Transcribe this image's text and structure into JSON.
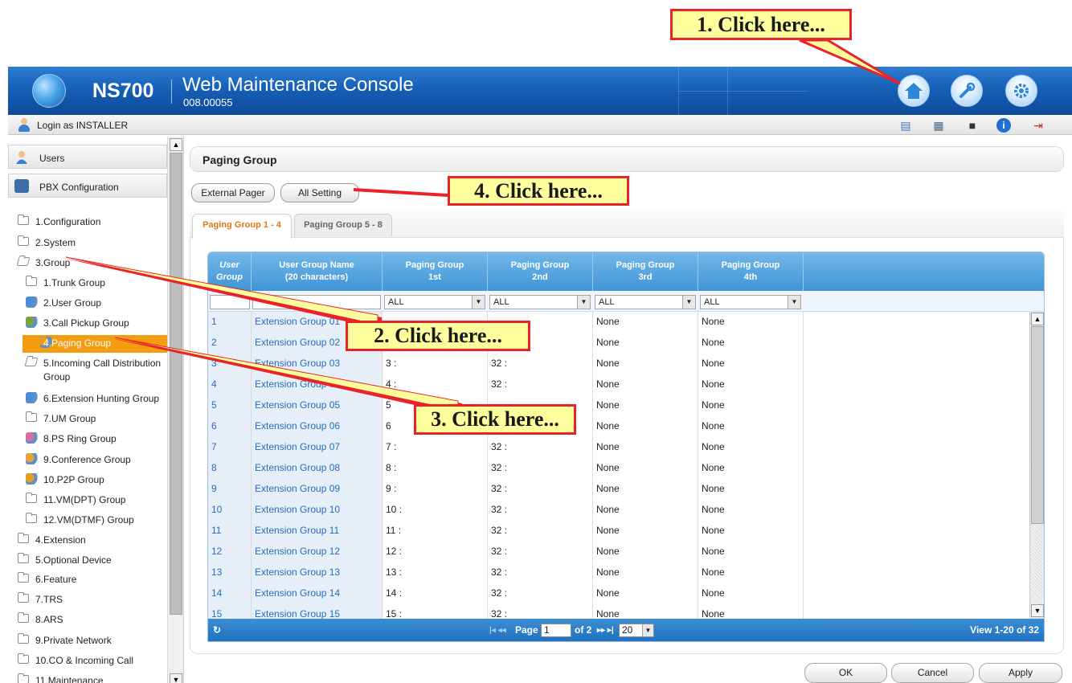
{
  "header": {
    "product": "NS700",
    "app_title": "Web Maintenance Console",
    "version": "008.00055",
    "home_icon": "home-icon",
    "tools_icon": "wrench-icon",
    "settings_icon": "gear-icon",
    "colors": {
      "header_blue": "#1660b6",
      "accent_orange": "#f39c12",
      "callout_red": "#e8242a",
      "callout_yellow": "#ffff9d"
    }
  },
  "loginbar": {
    "label": "Login as INSTALLER"
  },
  "sidebar": {
    "users": "Users",
    "pbx": "PBX Configuration",
    "top_items": [
      "1.Configuration",
      "2.System",
      "3.Group"
    ],
    "group_items": [
      "1.Trunk Group",
      "2.User Group",
      "3.Call Pickup Group",
      "4.Paging Group",
      "5.Incoming Call Distribution Group",
      "6.Extension Hunting Group",
      "7.UM Group",
      "8.PS Ring Group",
      "9.Conference Group",
      "10.P2P Group",
      "11.VM(DPT) Group",
      "12.VM(DTMF) Group"
    ],
    "incd_line1": "5.Incoming Call Distribution",
    "incd_line2": "Group",
    "bottom_items": [
      "4.Extension",
      "5.Optional Device",
      "6.Feature",
      "7.TRS",
      "8.ARS",
      "9.Private Network",
      "10.CO & Incoming Call",
      "11.Maintenance"
    ]
  },
  "page": {
    "title": "Paging Group",
    "external_pager": "External Pager",
    "all_setting": "All Setting",
    "tabs": [
      "Paging Group 1 - 4",
      "Paging Group 5 - 8"
    ]
  },
  "grid": {
    "headers": [
      {
        "l1": "User",
        "l2": "Group"
      },
      {
        "l1": "User Group Name",
        "l2": "(20 characters)"
      },
      {
        "l1": "Paging Group",
        "l2": "1st"
      },
      {
        "l1": "Paging Group",
        "l2": "2nd"
      },
      {
        "l1": "Paging Group",
        "l2": "3rd"
      },
      {
        "l1": "Paging Group",
        "l2": "4th"
      }
    ],
    "filter_all": "ALL",
    "rows": [
      [
        "1",
        "Extension Group 01",
        "",
        "",
        "None",
        "None"
      ],
      [
        "2",
        "Extension Group 02",
        "",
        "",
        "None",
        "None"
      ],
      [
        "3",
        "Extension Group 03",
        "3 :",
        "32 :",
        "None",
        "None"
      ],
      [
        "4",
        "Extension Group 04",
        "4 :",
        "32 :",
        "None",
        "None"
      ],
      [
        "5",
        "Extension Group 05",
        "5",
        "",
        "None",
        "None"
      ],
      [
        "6",
        "Extension Group 06",
        "6",
        "",
        "None",
        "None"
      ],
      [
        "7",
        "Extension Group 07",
        "7 :",
        "32 :",
        "None",
        "None"
      ],
      [
        "8",
        "Extension Group 08",
        "8 :",
        "32 :",
        "None",
        "None"
      ],
      [
        "9",
        "Extension Group 09",
        "9 :",
        "32 :",
        "None",
        "None"
      ],
      [
        "10",
        "Extension Group 10",
        "10 :",
        "32 :",
        "None",
        "None"
      ],
      [
        "11",
        "Extension Group 11",
        "11 :",
        "32 :",
        "None",
        "None"
      ],
      [
        "12",
        "Extension Group 12",
        "12 :",
        "32 :",
        "None",
        "None"
      ],
      [
        "13",
        "Extension Group 13",
        "13 :",
        "32 :",
        "None",
        "None"
      ],
      [
        "14",
        "Extension Group 14",
        "14 :",
        "32 :",
        "None",
        "None"
      ],
      [
        "15",
        "Extension Group 15",
        "15 :",
        "32 :",
        "None",
        "None"
      ]
    ],
    "footer": {
      "page_label": "Page",
      "page_value": "1",
      "of_label": "of 2",
      "per_page": "20",
      "view": "View 1-20 of 32"
    }
  },
  "buttons": {
    "ok": "OK",
    "cancel": "Cancel",
    "apply": "Apply"
  },
  "callouts": [
    "1. Click here...",
    "2. Click here...",
    "3. Click here...",
    "4. Click here..."
  ]
}
